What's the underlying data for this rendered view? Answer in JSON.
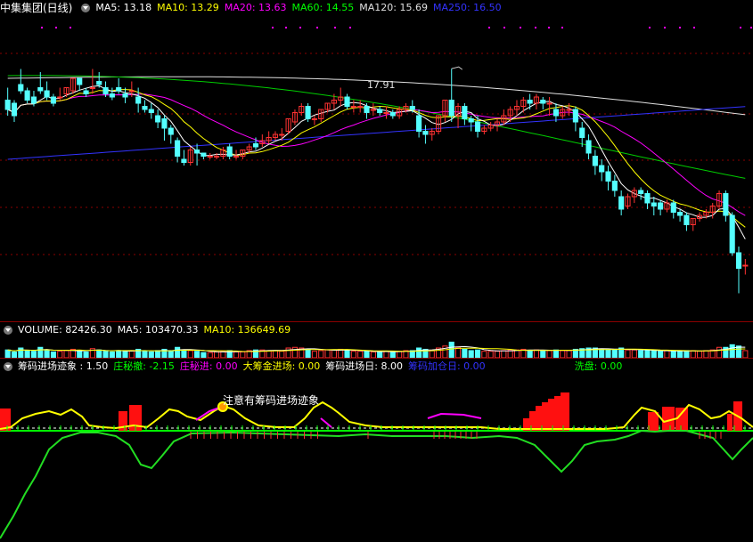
{
  "stock_title": "中集集团(日线)",
  "price_header": [
    {
      "label": "MA5: 13.18",
      "color": "#ffffff"
    },
    {
      "label": "MA10: 13.29",
      "color": "#ffff00"
    },
    {
      "label": "MA20: 13.63",
      "color": "#ff00ff"
    },
    {
      "label": "MA60: 14.55",
      "color": "#00ff00"
    },
    {
      "label": "MA120: 15.69",
      "color": "#e0e0e0"
    },
    {
      "label": "MA250: 16.50",
      "color": "#3333ff"
    }
  ],
  "volume_header": [
    {
      "label": "VOLUME: 82426.30",
      "color": "#ffffff"
    },
    {
      "label": "MA5: 103470.33",
      "color": "#ffffff"
    },
    {
      "label": "MA10: 136649.69",
      "color": "#ffff00"
    }
  ],
  "indicator_header": [
    {
      "label": "筹码进场迹象 : 1.50",
      "color": "#ffffff"
    },
    {
      "label": "庄秘撤: -2.15",
      "color": "#00ff00"
    },
    {
      "label": "庄秘进: 0.00",
      "color": "#ff00ff"
    },
    {
      "label": "大筹金进场: 0.00",
      "color": "#ffff00"
    },
    {
      "label": "筹码进场日: 8.00",
      "color": "#ffffff"
    },
    {
      "label": "筹码加仓日: 0.00",
      "color": "#3333ff"
    },
    {
      "label": "洗盘: 0.00",
      "color": "#00ff00"
    }
  ],
  "peak_label": "17.91",
  "annotation": "注意有筹码进场迹象",
  "colors": {
    "up": "#ff3232",
    "down": "#54ffff",
    "bg": "#000000",
    "grid": "#8b0000"
  },
  "chart_data": {
    "type": "candlestick",
    "ylim": [
      10.4,
      19.6
    ],
    "candles": [
      [
        16.9,
        17.3,
        16.6,
        16.4
      ],
      [
        16.8,
        16.9,
        16.4,
        16.2
      ],
      [
        17.4,
        17.9,
        17.2,
        17.1
      ],
      [
        17.2,
        17.3,
        16.9,
        16.8
      ],
      [
        17.0,
        17.2,
        16.8,
        16.7
      ],
      [
        17.3,
        17.8,
        17.2,
        17.1
      ],
      [
        17.2,
        17.5,
        17.0,
        16.9
      ],
      [
        17.0,
        17.1,
        16.8,
        16.7
      ],
      [
        17.0,
        17.3,
        17.0,
        16.9
      ],
      [
        17.1,
        17.3,
        17.3,
        17.0
      ],
      [
        17.2,
        17.6,
        17.6,
        17.1
      ],
      [
        17.6,
        17.6,
        17.4,
        17.2
      ],
      [
        17.2,
        17.3,
        17.1,
        17.0
      ],
      [
        17.3,
        17.9,
        17.3,
        17.1
      ],
      [
        17.5,
        17.8,
        17.4,
        17.3
      ],
      [
        17.3,
        17.5,
        17.1,
        17.0
      ],
      [
        17.1,
        17.3,
        17.0,
        16.9
      ],
      [
        17.3,
        17.6,
        17.2,
        17.1
      ],
      [
        17.1,
        17.3,
        17.0,
        16.8
      ],
      [
        17.2,
        17.5,
        17.2,
        17.0
      ],
      [
        17.0,
        17.3,
        16.8,
        16.5
      ],
      [
        16.7,
        16.9,
        16.6,
        16.5
      ],
      [
        16.6,
        16.8,
        16.5,
        16.3
      ],
      [
        16.4,
        16.6,
        16.2,
        16.0
      ],
      [
        16.3,
        16.4,
        16.0,
        15.6
      ],
      [
        16.0,
        16.1,
        15.8,
        15.5
      ],
      [
        15.6,
        15.7,
        15.1,
        14.9
      ],
      [
        15.0,
        15.3,
        14.9,
        14.8
      ],
      [
        14.9,
        15.4,
        15.3,
        14.8
      ],
      [
        15.3,
        15.5,
        15.2,
        14.8
      ],
      [
        15.2,
        15.2,
        15.1,
        15.0
      ],
      [
        15.1,
        15.2,
        15.1,
        15.0
      ],
      [
        15.1,
        15.2,
        15.1,
        15.0
      ],
      [
        15.1,
        15.4,
        15.3,
        15.0
      ],
      [
        15.4,
        15.5,
        15.1,
        15.0
      ],
      [
        15.1,
        15.3,
        15.1,
        15.0
      ],
      [
        15.1,
        15.3,
        15.3,
        15.0
      ],
      [
        15.3,
        15.5,
        15.4,
        15.2
      ],
      [
        15.5,
        15.7,
        15.4,
        15.3
      ],
      [
        15.5,
        15.8,
        15.6,
        15.4
      ],
      [
        15.6,
        15.9,
        15.7,
        15.5
      ],
      [
        15.7,
        15.9,
        15.8,
        15.6
      ],
      [
        15.8,
        16.0,
        15.8,
        15.6
      ],
      [
        15.9,
        16.3,
        16.3,
        15.8
      ],
      [
        16.2,
        16.6,
        16.5,
        16.1
      ],
      [
        16.5,
        16.8,
        16.7,
        16.4
      ],
      [
        16.7,
        16.8,
        16.3,
        16.2
      ],
      [
        16.3,
        16.4,
        16.3,
        16.1
      ],
      [
        16.3,
        16.6,
        16.6,
        16.2
      ],
      [
        16.6,
        16.8,
        16.8,
        16.5
      ],
      [
        16.8,
        17.1,
        16.9,
        16.6
      ],
      [
        16.9,
        17.3,
        17.0,
        16.7
      ],
      [
        17.0,
        17.1,
        16.7,
        16.6
      ],
      [
        16.7,
        16.9,
        16.7,
        16.5
      ],
      [
        16.7,
        16.9,
        16.7,
        16.5
      ],
      [
        16.7,
        16.8,
        16.5,
        16.3
      ],
      [
        16.6,
        16.8,
        16.6,
        16.4
      ],
      [
        16.6,
        16.7,
        16.5,
        16.4
      ],
      [
        16.5,
        16.7,
        16.5,
        16.3
      ],
      [
        16.5,
        16.6,
        16.4,
        16.3
      ],
      [
        16.4,
        16.7,
        16.6,
        16.3
      ],
      [
        16.6,
        16.8,
        16.7,
        16.5
      ],
      [
        16.7,
        16.9,
        16.6,
        16.5
      ],
      [
        16.4,
        16.6,
        15.9,
        15.7
      ],
      [
        15.9,
        16.1,
        15.8,
        15.5
      ],
      [
        15.8,
        16.0,
        15.9,
        15.6
      ],
      [
        15.9,
        16.4,
        16.4,
        15.8
      ],
      [
        16.4,
        16.9,
        16.9,
        16.2
      ],
      [
        16.9,
        17.91,
        16.4,
        16.2
      ],
      [
        16.4,
        16.8,
        16.7,
        16.0
      ],
      [
        16.7,
        16.8,
        16.3,
        16.1
      ],
      [
        16.3,
        16.4,
        16.2,
        15.9
      ],
      [
        16.2,
        16.4,
        15.9,
        15.7
      ],
      [
        15.9,
        16.1,
        16.0,
        15.8
      ],
      [
        16.0,
        16.2,
        16.1,
        15.9
      ],
      [
        16.1,
        16.3,
        16.2,
        15.9
      ],
      [
        16.2,
        16.6,
        16.4,
        16.1
      ],
      [
        16.4,
        16.7,
        16.6,
        16.2
      ],
      [
        16.6,
        16.9,
        16.7,
        16.4
      ],
      [
        16.7,
        17.0,
        16.9,
        16.5
      ],
      [
        16.9,
        17.1,
        16.8,
        16.6
      ],
      [
        16.8,
        17.1,
        17.0,
        16.6
      ],
      [
        16.9,
        17.0,
        16.8,
        16.6
      ],
      [
        16.8,
        17.0,
        16.8,
        16.4
      ],
      [
        16.6,
        16.8,
        16.4,
        16.2
      ],
      [
        16.4,
        16.7,
        16.6,
        16.3
      ],
      [
        16.6,
        16.8,
        16.6,
        16.4
      ],
      [
        16.6,
        16.7,
        16.2,
        15.9
      ],
      [
        16.0,
        16.2,
        15.7,
        15.4
      ],
      [
        15.6,
        15.8,
        15.2,
        15.0
      ],
      [
        15.1,
        15.3,
        14.8,
        14.5
      ],
      [
        14.8,
        15.0,
        14.6,
        14.3
      ],
      [
        14.6,
        14.8,
        14.3,
        14.0
      ],
      [
        14.3,
        14.5,
        14.0,
        13.8
      ],
      [
        13.8,
        14.0,
        13.4,
        13.2
      ],
      [
        13.5,
        13.9,
        13.8,
        13.4
      ],
      [
        13.8,
        14.1,
        14.0,
        13.6
      ],
      [
        14.0,
        14.1,
        13.9,
        13.7
      ],
      [
        13.9,
        14.0,
        13.6,
        13.4
      ],
      [
        13.6,
        13.8,
        13.5,
        13.2
      ],
      [
        13.6,
        13.7,
        13.4,
        13.2
      ],
      [
        13.4,
        13.7,
        13.6,
        13.3
      ],
      [
        13.6,
        13.7,
        13.3,
        13.1
      ],
      [
        13.3,
        13.4,
        13.2,
        13.0
      ],
      [
        13.2,
        13.3,
        12.9,
        12.7
      ],
      [
        12.9,
        13.1,
        13.1,
        12.7
      ],
      [
        13.1,
        13.3,
        13.2,
        13.0
      ],
      [
        13.2,
        13.4,
        13.3,
        13.1
      ],
      [
        13.3,
        13.6,
        13.5,
        13.1
      ],
      [
        13.5,
        14.0,
        13.9,
        13.4
      ],
      [
        13.9,
        14.0,
        13.2,
        13.0
      ],
      [
        13.2,
        13.3,
        12.0,
        11.9
      ],
      [
        12.0,
        12.2,
        11.5,
        10.7
      ],
      [
        11.6,
        11.8,
        11.6,
        11.3
      ]
    ],
    "volume": [
      120,
      90,
      150,
      110,
      100,
      160,
      120,
      90,
      100,
      110,
      130,
      110,
      90,
      140,
      120,
      100,
      90,
      110,
      100,
      110,
      130,
      100,
      90,
      110,
      130,
      110,
      160,
      120,
      110,
      100,
      80,
      80,
      90,
      100,
      110,
      90,
      90,
      110,
      120,
      120,
      110,
      110,
      100,
      150,
      160,
      150,
      130,
      100,
      110,
      120,
      120,
      130,
      110,
      100,
      100,
      100,
      90,
      90,
      100,
      90,
      100,
      110,
      110,
      150,
      130,
      110,
      150,
      180,
      240,
      160,
      130,
      110,
      120,
      100,
      100,
      100,
      110,
      120,
      120,
      130,
      110,
      120,
      110,
      110,
      120,
      110,
      110,
      130,
      140,
      150,
      150,
      130,
      120,
      120,
      150,
      120,
      120,
      110,
      110,
      110,
      100,
      110,
      100,
      100,
      110,
      110,
      100,
      110,
      120,
      160,
      160,
      200,
      180,
      110
    ],
    "volume_ylim": [
      0,
      300
    ],
    "indicator": {
      "series": [
        "筹码进场迹象",
        "庄秘撤",
        "庄秘进",
        "大筹金进场",
        "筹码进场日",
        "筹码加仓日",
        "洗盘"
      ]
    }
  }
}
